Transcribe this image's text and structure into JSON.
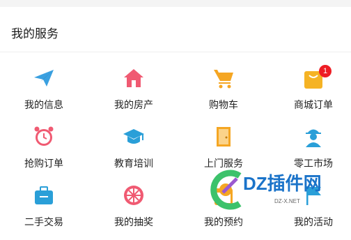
{
  "section": {
    "title": "我的服务"
  },
  "services": {
    "items": [
      {
        "label": "我的信息",
        "icon": "paper-plane-icon",
        "color": "#3aa0e0"
      },
      {
        "label": "我的房产",
        "icon": "house-icon",
        "color": "#f05a72"
      },
      {
        "label": "购物车",
        "icon": "shopping-cart-icon",
        "color": "#f5a623"
      },
      {
        "label": "商城订单",
        "icon": "shopping-bag-icon",
        "color": "#f5b324",
        "badge": "1"
      },
      {
        "label": "抢购订单",
        "icon": "alarm-clock-icon",
        "color": "#f05a72"
      },
      {
        "label": "教育培训",
        "icon": "graduation-cap-icon",
        "color": "#2a9fd8"
      },
      {
        "label": "上门服务",
        "icon": "door-icon",
        "color": "#f5a623"
      },
      {
        "label": "零工市场",
        "icon": "worker-icon",
        "color": "#2a9fd8"
      },
      {
        "label": "二手交易",
        "icon": "briefcase-icon",
        "color": "#2a9fd8"
      },
      {
        "label": "我的抽奖",
        "icon": "prize-wheel-icon",
        "color": "#f05a72"
      },
      {
        "label": "我的预约",
        "icon": "calendar-icon",
        "color": "#f5a623"
      },
      {
        "label": "我的活动",
        "icon": "flag-icon",
        "color": "#2a9fd8"
      }
    ]
  },
  "watermark": {
    "text": "DZ插件网",
    "sub": "DZ-X.NET"
  }
}
